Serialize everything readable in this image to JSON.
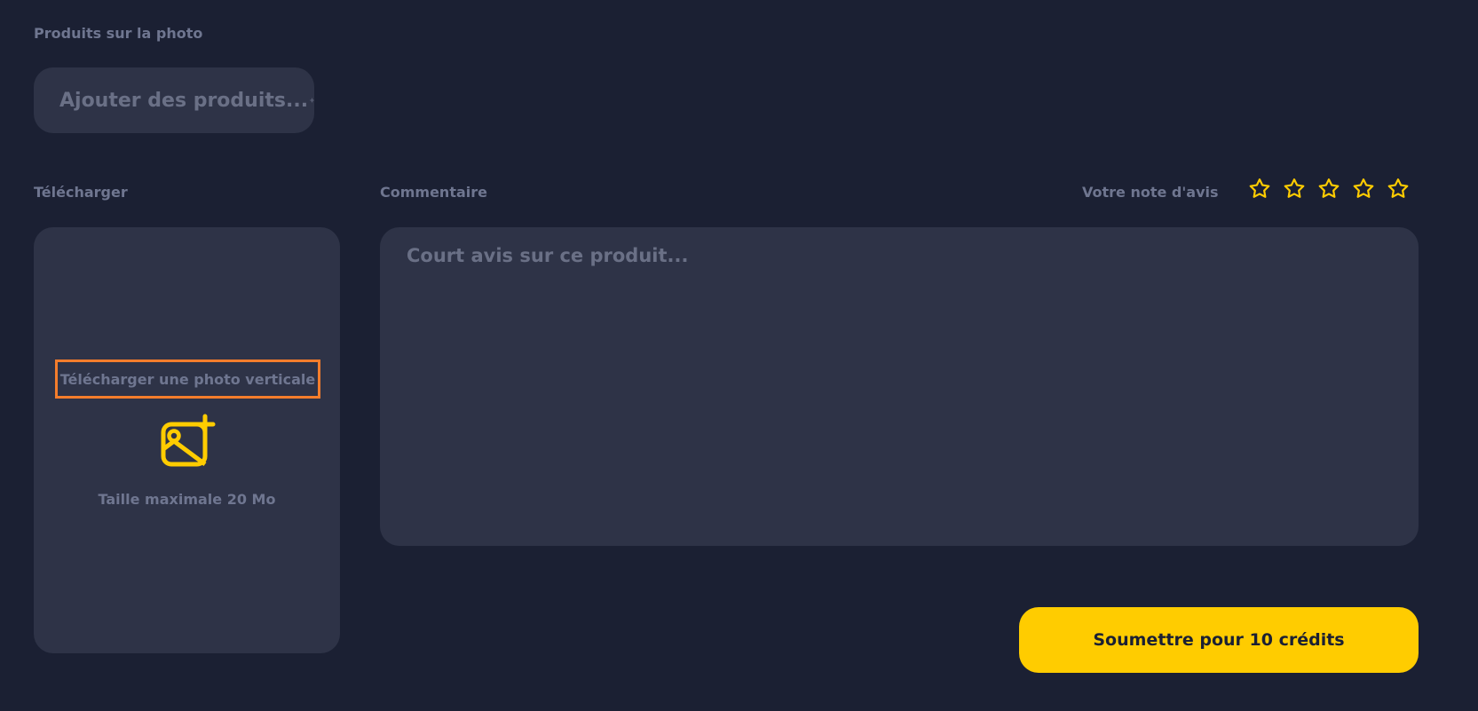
{
  "products_section": {
    "label": "Produits sur la photo",
    "add_button_label": "Ajouter des produits...",
    "add_icon": "plus-icon"
  },
  "upload_section": {
    "label": "Télécharger",
    "prompt": "Télécharger une photo verticale",
    "icon": "image-add-icon",
    "max_size": "Taille maximale 20 Mo"
  },
  "comment_section": {
    "label": "Commentaire",
    "placeholder": "Court avis sur ce produit...",
    "value": ""
  },
  "rating": {
    "label": "Votre note d'avis",
    "max_stars": 5,
    "selected": 0,
    "star_icon": "star-outline-icon",
    "star_color": "#ffcc00"
  },
  "submit_button": {
    "label": "Soumettre pour 10 crédits",
    "color": "#ffcc00"
  },
  "colors": {
    "background": "#1b2033",
    "panel": "#2e3347",
    "muted_text": "#6f7690",
    "accent": "#ffcc00",
    "highlight_border": "#f47d2c"
  }
}
